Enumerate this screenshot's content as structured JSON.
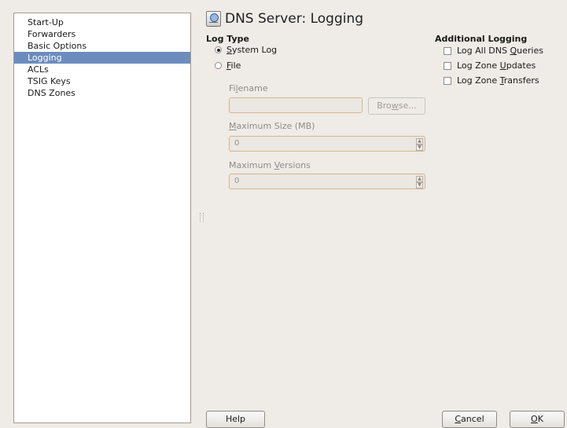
{
  "window": {
    "title": "DNS Server: Logging",
    "icon": "dns-server-icon"
  },
  "sidebar": {
    "items": [
      {
        "label": "Start-Up"
      },
      {
        "label": "Forwarders"
      },
      {
        "label": "Basic Options"
      },
      {
        "label": "Logging",
        "selected": true
      },
      {
        "label": "ACLs"
      },
      {
        "label": "TSIG Keys"
      },
      {
        "label": "DNS Zones"
      }
    ],
    "selected_color": "#6c8cbd"
  },
  "log_type": {
    "heading": "Log Type",
    "options": [
      {
        "mnemonic": "S",
        "rest": "ystem Log",
        "checked": true
      },
      {
        "mnemonic": "F",
        "rest": "ile",
        "checked": false
      }
    ]
  },
  "file": {
    "filename_pre": "Fi",
    "filename_mn": "l",
    "filename_post": "ename",
    "filename_value": "",
    "browse_pre": "Bro",
    "browse_mn": "w",
    "browse_post": "se...",
    "max_size_mn": "M",
    "max_size_post": "aximum Size (MB)",
    "max_size_value": "0",
    "max_versions_pre": "Maximum ",
    "max_versions_mn": "V",
    "max_versions_post": "ersions",
    "max_versions_value": "0"
  },
  "additional": {
    "heading": "Additional Logging",
    "options": [
      {
        "pre": "Log All DNS ",
        "mn": "Q",
        "post": "ueries",
        "checked": false
      },
      {
        "pre": "Log Zone ",
        "mn": "U",
        "post": "pdates",
        "checked": false
      },
      {
        "pre": "Log Zone ",
        "mn": "T",
        "post": "ransfers",
        "checked": false
      }
    ]
  },
  "buttons": {
    "help": "Help",
    "cancel_mn": "C",
    "cancel_post": "ancel",
    "ok_mn": "O",
    "ok_post": "K"
  }
}
